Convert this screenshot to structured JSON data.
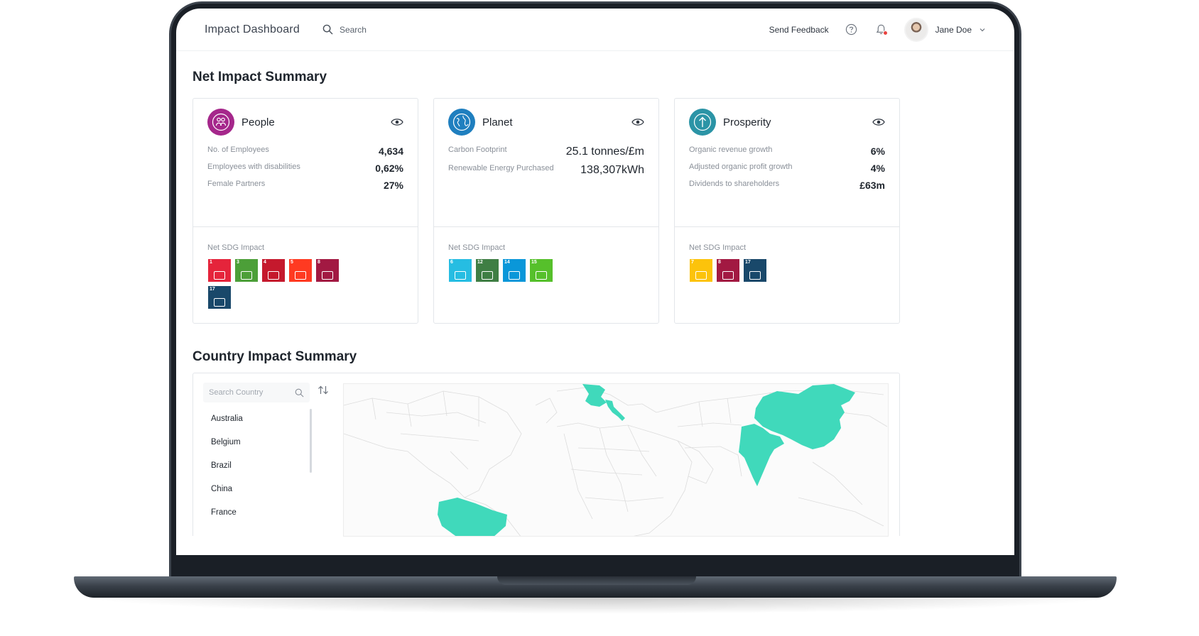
{
  "app": {
    "title": "Impact Dashboard"
  },
  "topbar": {
    "search_label": "Search",
    "feedback_label": "Send Feedback",
    "user_name": "Jane Doe"
  },
  "summary": {
    "title": "Net Impact Summary",
    "sdg_label": "Net SDG Impact",
    "cards": [
      {
        "title": "People",
        "color": "#a5278b",
        "metrics": [
          {
            "label": "No. of Employees",
            "value": "4,634"
          },
          {
            "label": "Employees with disabilities",
            "value": "0,62%"
          },
          {
            "label": "Female Partners",
            "value": "27%"
          }
        ],
        "sdgs": [
          {
            "num": "1",
            "color": "#e5243b",
            "icon": "people-icon"
          },
          {
            "num": "3",
            "color": "#4c9f38",
            "icon": "heartbeat-icon"
          },
          {
            "num": "4",
            "color": "#c5192d",
            "icon": "book-icon"
          },
          {
            "num": "5",
            "color": "#ff3a21",
            "icon": "gender-icon"
          },
          {
            "num": "8",
            "color": "#a21942",
            "icon": "growth-chart-icon"
          },
          {
            "num": "17",
            "color": "#19486a",
            "icon": "partnership-icon"
          }
        ]
      },
      {
        "title": "Planet",
        "color": "#1f7fbf",
        "metrics": [
          {
            "label": "Carbon Footprint",
            "value": "25.1 tonnes/£m"
          },
          {
            "label": "Renewable Energy Purchased",
            "value": "138,307kWh"
          }
        ],
        "sdgs": [
          {
            "num": "6",
            "color": "#26bde2",
            "icon": "water-icon"
          },
          {
            "num": "12",
            "color": "#3f7e44",
            "icon": "infinity-eye-icon"
          },
          {
            "num": "14",
            "color": "#0a97d9",
            "icon": "fish-icon"
          },
          {
            "num": "15",
            "color": "#56c02b",
            "icon": "tree-icon"
          }
        ]
      },
      {
        "title": "Prosperity",
        "color": "#2b94a6",
        "metrics": [
          {
            "label": "Organic revenue growth",
            "value": "6%"
          },
          {
            "label": "Adjusted organic profit growth",
            "value": "4%"
          },
          {
            "label": "Dividends to shareholders",
            "value": "£63m"
          }
        ],
        "sdgs": [
          {
            "num": "7",
            "color": "#fcc30b",
            "icon": "sun-icon"
          },
          {
            "num": "8",
            "color": "#a21942",
            "icon": "growth-chart-icon"
          },
          {
            "num": "17",
            "color": "#19486a",
            "icon": "partnership-icon"
          }
        ]
      }
    ]
  },
  "country": {
    "title": "Country Impact Summary",
    "search_placeholder": "Search Country",
    "countries": [
      "Australia",
      "Belgium",
      "Brazil",
      "China",
      "France"
    ],
    "highlight_color": "#40d9bb"
  }
}
